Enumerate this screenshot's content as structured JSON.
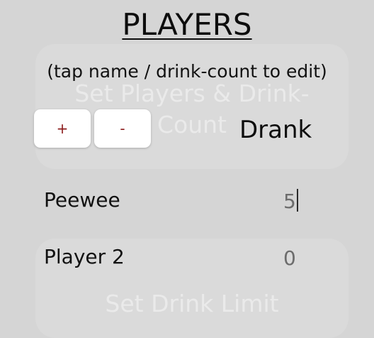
{
  "screen": {
    "title": "PLAYERS",
    "subtitle": "(tap name / drink-count to edit)"
  },
  "toolbar": {
    "add_label": "+",
    "remove_label": "-"
  },
  "table": {
    "drank_header": "Drank"
  },
  "players": [
    {
      "name": "Peewee",
      "drank": "5",
      "editing": true
    },
    {
      "name": "Player 2",
      "drank": "0",
      "editing": false
    }
  ],
  "background_menu": {
    "set_players_line1": "Set Players & Drink-",
    "set_players_line2": "Count",
    "set_drink_limit": "Set Drink Limit"
  },
  "colors": {
    "background": "#d5d5d5",
    "button_background": "#ffffff",
    "button_text": "#8b1a1a",
    "count_text": "#6c6c6c"
  }
}
